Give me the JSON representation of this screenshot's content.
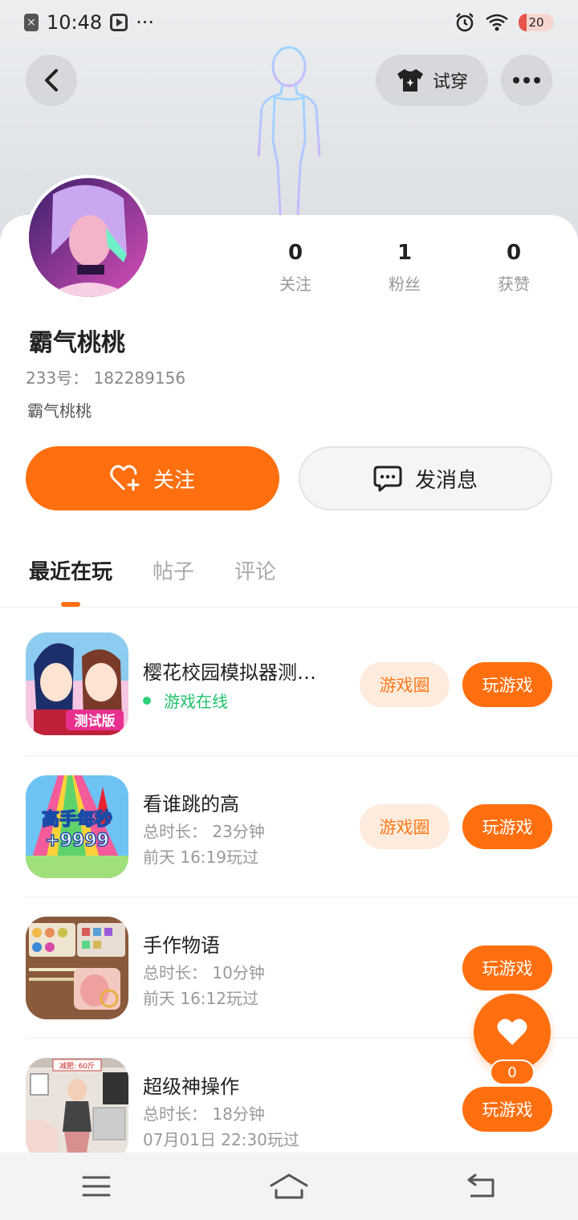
{
  "status_bar": {
    "time": "10:48",
    "dots": "···",
    "battery": "20"
  },
  "header": {
    "try_on_label": "试穿"
  },
  "profile": {
    "stats": [
      {
        "value": "0",
        "label": "关注"
      },
      {
        "value": "1",
        "label": "粉丝"
      },
      {
        "value": "0",
        "label": "获赞"
      }
    ],
    "username": "霸气桃桃",
    "uid": "233号： 182289156",
    "bio": "霸气桃桃"
  },
  "actions": {
    "follow_label": "关注",
    "message_label": "发消息"
  },
  "tabs": [
    {
      "label": "最近在玩",
      "active": true
    },
    {
      "label": "帖子",
      "active": false
    },
    {
      "label": "评论",
      "active": false
    }
  ],
  "games": [
    {
      "title": "樱花校园模拟器测…",
      "status": "游戏在线",
      "circle_label": "游戏圈",
      "play_label": "玩游戏",
      "icon_text": "测试版"
    },
    {
      "title": "看谁跳的高",
      "duration": "总时长：  23分钟",
      "last_played": "前天  16:19玩过",
      "circle_label": "游戏圈",
      "play_label": "玩游戏",
      "icon_text_1": "高手每秒",
      "icon_text_2": "+9999"
    },
    {
      "title": "手作物语",
      "duration": "总时长：  10分钟",
      "last_played": "前天  16:12玩过",
      "play_label": "玩游戏"
    },
    {
      "title": "超级神操作",
      "duration": "总时长：  18分钟",
      "last_played": "07月01日  22:30玩过",
      "play_label": "玩游戏",
      "icon_text": "减肥: 60斤"
    }
  ],
  "float_like": {
    "count": "0"
  },
  "colors": {
    "accent": "#ff6f0f",
    "online": "#1fc26b",
    "circle_bg": "#fdebdd"
  }
}
